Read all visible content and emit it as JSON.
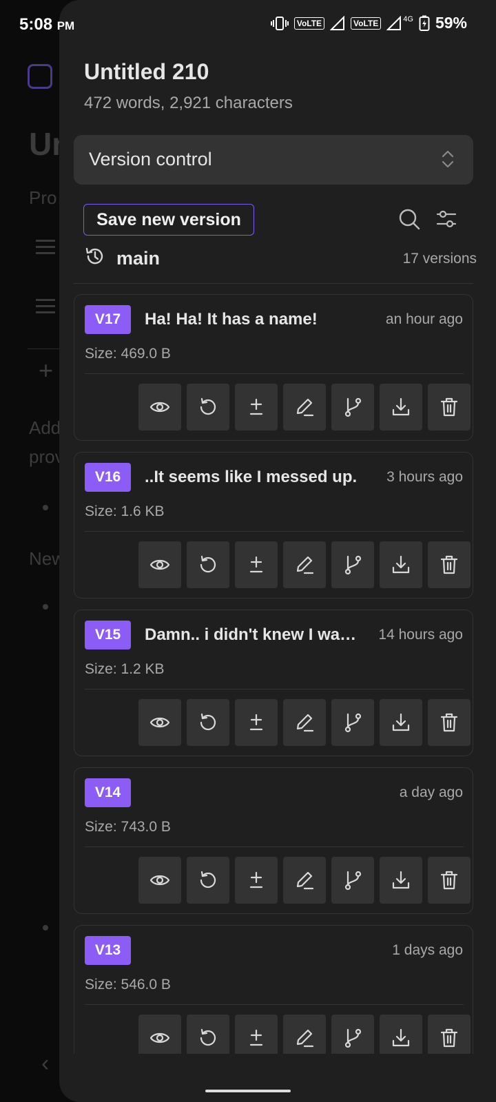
{
  "status_bar": {
    "time": "5:08",
    "ampm": "PM",
    "volte1": "VoLTE",
    "volte2": "VoLTE",
    "network": "4G",
    "battery": "59%"
  },
  "background": {
    "title": "Un",
    "lines": [
      "Pro",
      "Add",
      "prov",
      "New"
    ]
  },
  "panel": {
    "doc_title": "Untitled 210",
    "doc_stats": "472 words, 2,921 characters",
    "select_label": "Version control",
    "save_button": "Save new version",
    "branch_name": "main",
    "version_count": "17 versions"
  },
  "versions": [
    {
      "badge": "V17",
      "name": "Ha! Ha! It has a name!",
      "time": "an hour ago",
      "size": "Size: 469.0 B"
    },
    {
      "badge": "V16",
      "name": "..It seems like I messed up.",
      "time": "3 hours ago",
      "size": "Size: 1.6 KB"
    },
    {
      "badge": "V15",
      "name": "Damn.. i didn't knew I wa…",
      "time": "14 hours ago",
      "size": "Size: 1.2 KB"
    },
    {
      "badge": "V14",
      "name": "",
      "time": "a day ago",
      "size": "Size: 743.0 B"
    },
    {
      "badge": "V13",
      "name": "",
      "time": "1 days ago",
      "size": "Size: 546.0 B"
    }
  ],
  "icons": {
    "actions": [
      "eye-icon",
      "restore-icon",
      "diff-icon",
      "edit-icon",
      "branch-icon",
      "download-icon",
      "delete-icon"
    ]
  },
  "colors": {
    "accent": "#8b5cf6",
    "panel_bg": "#1f1f1f",
    "button_bg": "#333333"
  }
}
